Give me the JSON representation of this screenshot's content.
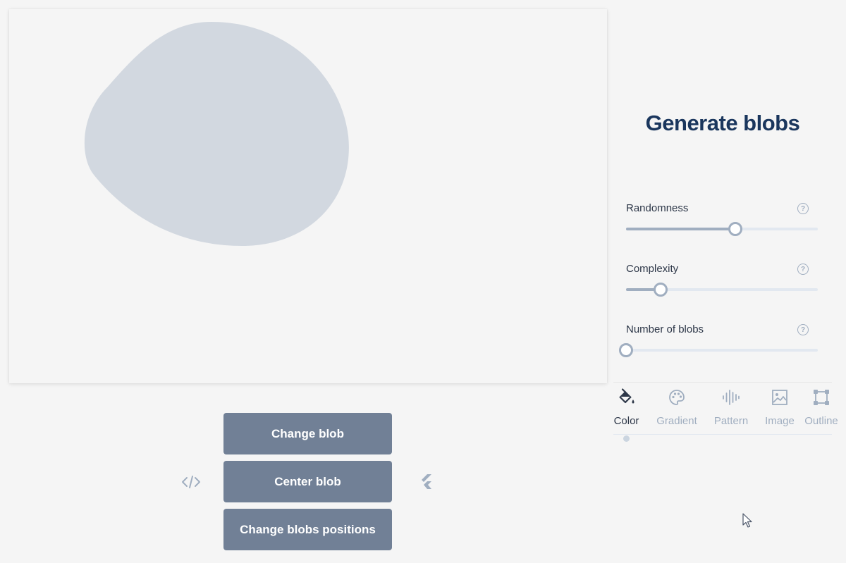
{
  "canvas": {
    "blob_color": "#d2d8e0",
    "background_color": "#f5f5f5"
  },
  "actions": {
    "change_blob": "Change blob",
    "center_blob": "Center blob",
    "change_positions": "Change blobs positions",
    "code_icon": "code-icon",
    "flutter_icon": "flutter-icon",
    "button_color": "#718096"
  },
  "panel": {
    "title": "Generate blobs",
    "title_color": "#1a365d",
    "controls": [
      {
        "label": "Randomness",
        "value": 0.57,
        "help": "?"
      },
      {
        "label": "Complexity",
        "value": 0.18,
        "help": "?"
      },
      {
        "label": "Number of blobs",
        "value": 0.0,
        "help": "?"
      }
    ],
    "tabs": [
      {
        "label": "Color",
        "icon": "paint-bucket-icon",
        "active": true
      },
      {
        "label": "Gradient",
        "icon": "palette-icon",
        "active": false
      },
      {
        "label": "Pattern",
        "icon": "soundwave-icon",
        "active": false
      },
      {
        "label": "Image",
        "icon": "image-icon",
        "active": false
      },
      {
        "label": "Outline",
        "icon": "outline-square-icon",
        "active": false
      }
    ]
  }
}
